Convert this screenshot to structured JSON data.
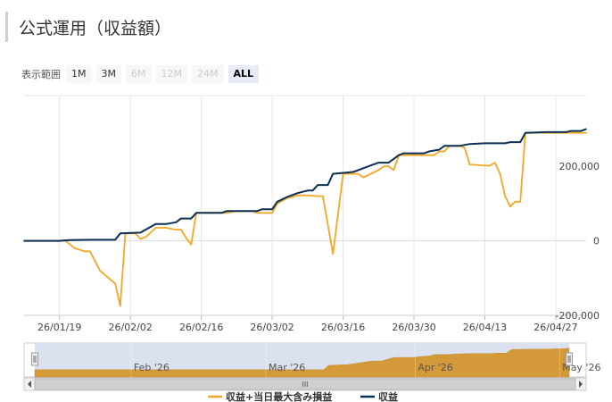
{
  "title": "公式運用（収益額）",
  "range_selector": {
    "label": "表示範囲",
    "buttons": [
      {
        "label": "1M",
        "state": "enabled"
      },
      {
        "label": "3M",
        "state": "enabled"
      },
      {
        "label": "6M",
        "state": "disabled"
      },
      {
        "label": "12M",
        "state": "disabled"
      },
      {
        "label": "24M",
        "state": "disabled"
      },
      {
        "label": "ALL",
        "state": "active"
      }
    ]
  },
  "navigator": {
    "month_labels": [
      "Feb '26",
      "Mar '26",
      "Apr '26",
      "May '26"
    ],
    "handle_glyph": "III"
  },
  "colors": {
    "orange": "#f5a623",
    "navy": "#0c2f55",
    "navigator_fill": "#d49a3a",
    "navigator_mask": "#dbe1ef"
  },
  "chart_data": {
    "type": "line",
    "x_tick_labels": [
      "26/01/19",
      "26/02/02",
      "26/02/16",
      "26/03/02",
      "26/03/16",
      "26/03/30",
      "26/04/13",
      "26/04/27"
    ],
    "x_ticks": [
      "2026-01-19",
      "2026-02-02",
      "2026-02-16",
      "2026-03-02",
      "2026-03-16",
      "2026-03-30",
      "2026-04-13",
      "2026-04-27"
    ],
    "x_range": [
      "2026-01-12",
      "2026-05-03"
    ],
    "y_ticks": [
      -200000,
      0,
      200000
    ],
    "y_tick_labels": [
      "-200,000",
      "0",
      "200,000"
    ],
    "ylim": [
      -200000,
      390000
    ],
    "grid": "vertical",
    "legend": "bottom",
    "series": [
      {
        "name": "収益+当日最大含み損益",
        "color": "#f5a623",
        "points": [
          [
            "2026-01-12",
            0
          ],
          [
            "2026-01-19",
            0
          ],
          [
            "2026-01-20",
            2000
          ],
          [
            "2026-01-22",
            -20000
          ],
          [
            "2026-01-24",
            -28000
          ],
          [
            "2026-01-25",
            -28000
          ],
          [
            "2026-01-27",
            -80000
          ],
          [
            "2026-01-30",
            -115000
          ],
          [
            "2026-01-31",
            -175000
          ],
          [
            "2026-02-01",
            20000
          ],
          [
            "2026-02-03",
            20000
          ],
          [
            "2026-02-04",
            5000
          ],
          [
            "2026-02-05",
            10000
          ],
          [
            "2026-02-07",
            35000
          ],
          [
            "2026-02-09",
            35000
          ],
          [
            "2026-02-11",
            30000
          ],
          [
            "2026-02-12",
            30000
          ],
          [
            "2026-02-13",
            8000
          ],
          [
            "2026-02-14",
            -10000
          ],
          [
            "2026-02-15",
            75000
          ],
          [
            "2026-02-21",
            75000
          ],
          [
            "2026-02-23",
            80000
          ],
          [
            "2026-02-26",
            80000
          ],
          [
            "2026-02-27",
            75000
          ],
          [
            "2026-03-02",
            75000
          ],
          [
            "2026-03-03",
            100000
          ],
          [
            "2026-03-05",
            115000
          ],
          [
            "2026-03-07",
            122000
          ],
          [
            "2026-03-09",
            122000
          ],
          [
            "2026-03-11",
            120000
          ],
          [
            "2026-03-12",
            120000
          ],
          [
            "2026-03-14",
            -35000
          ],
          [
            "2026-03-16",
            180000
          ],
          [
            "2026-03-19",
            180000
          ],
          [
            "2026-03-20",
            170000
          ],
          [
            "2026-03-23",
            190000
          ],
          [
            "2026-03-24",
            200000
          ],
          [
            "2026-03-25",
            200000
          ],
          [
            "2026-03-26",
            190000
          ],
          [
            "2026-03-27",
            230000
          ],
          [
            "2026-04-01",
            230000
          ],
          [
            "2026-04-03",
            230000
          ],
          [
            "2026-04-04",
            240000
          ],
          [
            "2026-04-05",
            240000
          ],
          [
            "2026-04-06",
            255000
          ],
          [
            "2026-04-08",
            255000
          ],
          [
            "2026-04-09",
            250000
          ],
          [
            "2026-04-10",
            205000
          ],
          [
            "2026-04-13",
            202000
          ],
          [
            "2026-04-14",
            202000
          ],
          [
            "2026-04-15",
            210000
          ],
          [
            "2026-04-16",
            180000
          ],
          [
            "2026-04-17",
            120000
          ],
          [
            "2026-04-18",
            92000
          ],
          [
            "2026-04-19",
            105000
          ],
          [
            "2026-04-20",
            105000
          ],
          [
            "2026-04-21",
            290000
          ],
          [
            "2026-04-29",
            290000
          ],
          [
            "2026-05-03",
            290000
          ]
        ]
      },
      {
        "name": "収益",
        "color": "#0c2f55",
        "points": [
          [
            "2026-01-12",
            0
          ],
          [
            "2026-01-19",
            0
          ],
          [
            "2026-01-21",
            2000
          ],
          [
            "2026-01-25",
            3000
          ],
          [
            "2026-01-30",
            3000
          ],
          [
            "2026-01-31",
            20000
          ],
          [
            "2026-02-04",
            22000
          ],
          [
            "2026-02-05",
            30000
          ],
          [
            "2026-02-07",
            45000
          ],
          [
            "2026-02-09",
            45000
          ],
          [
            "2026-02-11",
            50000
          ],
          [
            "2026-02-12",
            60000
          ],
          [
            "2026-02-14",
            60000
          ],
          [
            "2026-02-15",
            75000
          ],
          [
            "2026-02-20",
            75000
          ],
          [
            "2026-02-21",
            80000
          ],
          [
            "2026-02-27",
            80000
          ],
          [
            "2026-02-28",
            85000
          ],
          [
            "2026-03-02",
            85000
          ],
          [
            "2026-03-03",
            105000
          ],
          [
            "2026-03-05",
            118000
          ],
          [
            "2026-03-07",
            128000
          ],
          [
            "2026-03-09",
            135000
          ],
          [
            "2026-03-10",
            135000
          ],
          [
            "2026-03-11",
            150000
          ],
          [
            "2026-03-13",
            150000
          ],
          [
            "2026-03-14",
            180000
          ],
          [
            "2026-03-18",
            185000
          ],
          [
            "2026-03-19",
            190000
          ],
          [
            "2026-03-21",
            200000
          ],
          [
            "2026-03-23",
            210000
          ],
          [
            "2026-03-25",
            210000
          ],
          [
            "2026-03-27",
            230000
          ],
          [
            "2026-03-28",
            235000
          ],
          [
            "2026-03-31",
            235000
          ],
          [
            "2026-04-01",
            235000
          ],
          [
            "2026-04-02",
            240000
          ],
          [
            "2026-04-04",
            245000
          ],
          [
            "2026-04-05",
            255000
          ],
          [
            "2026-04-08",
            255000
          ],
          [
            "2026-04-10",
            260000
          ],
          [
            "2026-04-13",
            262000
          ],
          [
            "2026-04-17",
            262000
          ],
          [
            "2026-04-18",
            265000
          ],
          [
            "2026-04-20",
            265000
          ],
          [
            "2026-04-21",
            290000
          ],
          [
            "2026-04-25",
            292000
          ],
          [
            "2026-04-29",
            292000
          ],
          [
            "2026-04-30",
            295000
          ],
          [
            "2026-05-02",
            295000
          ],
          [
            "2026-05-03",
            300000
          ]
        ]
      }
    ]
  }
}
